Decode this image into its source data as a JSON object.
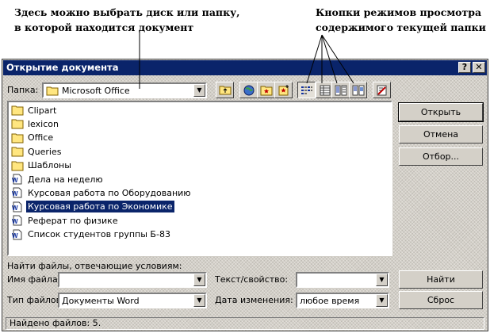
{
  "annotations": {
    "left_line1": "Здесь можно выбрать диск или папку,",
    "left_line2": "в которой находится документ",
    "right_line1": "Кнопки режимов просмотра",
    "right_line2": "содержимого текущей  папки"
  },
  "window": {
    "title": "Открытие документа",
    "help_glyph": "?",
    "close_glyph": "✕"
  },
  "folder": {
    "label": "Папка:",
    "value": "Microsoft Office",
    "icon": "folder-icon"
  },
  "toolbar": {
    "icons": [
      "up-folder-icon",
      "search-web-icon",
      "favorites-icon",
      "add-to-favorites-icon",
      "list-view-icon",
      "details-view-icon",
      "properties-view-icon",
      "preview-view-icon",
      "commands-settings-icon"
    ]
  },
  "files": [
    {
      "name": "Clipart",
      "type": "folder"
    },
    {
      "name": "lexicon",
      "type": "folder"
    },
    {
      "name": "Office",
      "type": "folder"
    },
    {
      "name": "Queries",
      "type": "folder"
    },
    {
      "name": "Шаблоны",
      "type": "folder"
    },
    {
      "name": "Дела на неделю",
      "type": "doc"
    },
    {
      "name": "Курсовая работа по Оборудованию",
      "type": "doc"
    },
    {
      "name": "Курсовая работа по Экономике",
      "type": "doc",
      "selected": true
    },
    {
      "name": "Реферат по физике",
      "type": "doc"
    },
    {
      "name": "Список студентов группы Б-83",
      "type": "doc"
    }
  ],
  "buttons": {
    "open": "Открыть",
    "cancel": "Отмена",
    "select": "Отбор...",
    "find": "Найти",
    "reset": "Сброс"
  },
  "search": {
    "heading": "Найти файлы, отвечающие условиям:",
    "filename_label": "Имя файла:",
    "filename_value": "",
    "filetype_label": "Тип файлов:",
    "filetype_value": "Документы Word",
    "text_label": "Текст/свойство:",
    "text_value": "",
    "date_label": "Дата изменения:",
    "date_value": "любое время"
  },
  "status": "Найдено файлов: 5.",
  "colors": {
    "dialog_face": "#d4d0c8",
    "titlebar": "#0a246a",
    "selection": "#0a246a",
    "folder_yellow": "#ffe680"
  }
}
